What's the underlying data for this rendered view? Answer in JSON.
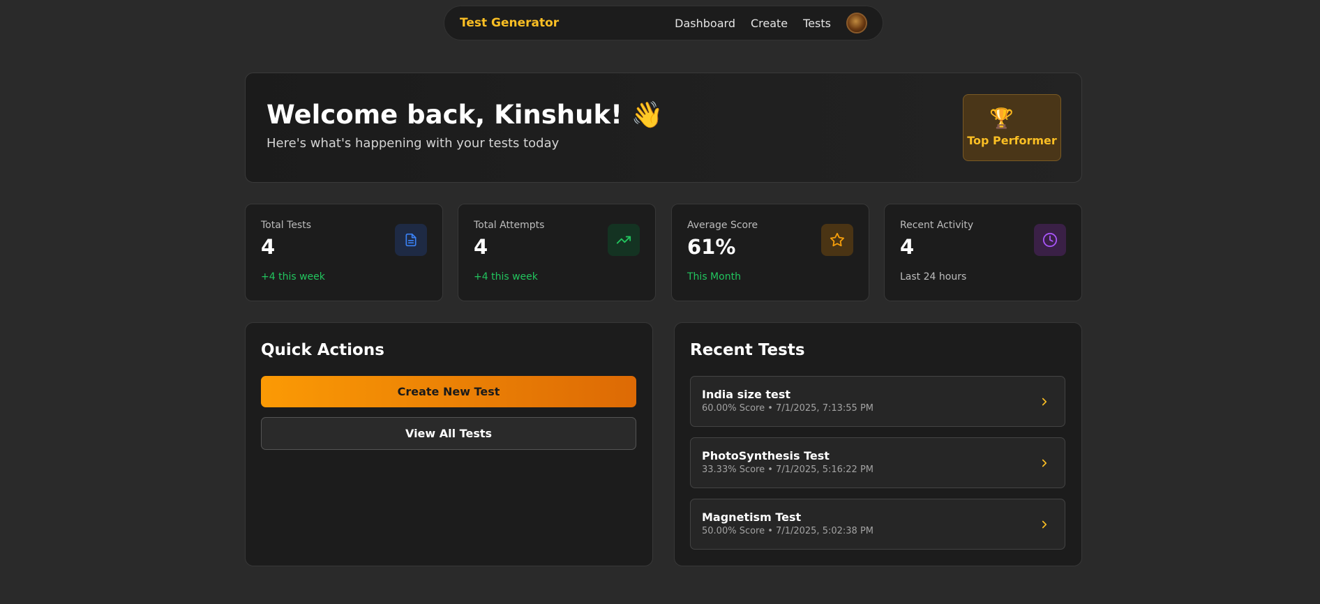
{
  "nav": {
    "brand": "Test Generator",
    "links": [
      "Dashboard",
      "Create",
      "Tests"
    ]
  },
  "welcome": {
    "title": "Welcome back, Kinshuk! 👋",
    "subtitle": "Here's what's happening with your tests today",
    "badge_icon": "🏆",
    "badge_label": "Top Performer"
  },
  "stats": [
    {
      "label": "Total Tests",
      "value": "4",
      "note": "+4 this week",
      "note_color": "#22c55e",
      "icon": "document-icon",
      "icon_bg": "#1e2a44",
      "icon_color": "#3b82f6"
    },
    {
      "label": "Total Attempts",
      "value": "4",
      "note": "+4 this week",
      "note_color": "#22c55e",
      "icon": "trending-up-icon",
      "icon_bg": "#143322",
      "icon_color": "#22c55e"
    },
    {
      "label": "Average Score",
      "value": "61%",
      "note": "This Month",
      "note_color": "#22c55e",
      "icon": "star-icon",
      "icon_bg": "#4a3414",
      "icon_color": "#f59e0b"
    },
    {
      "label": "Recent Activity",
      "value": "4",
      "note": "Last 24 hours",
      "note_color": "#bdbdbd",
      "icon": "clock-icon",
      "icon_bg": "#3a2046",
      "icon_color": "#a855f7"
    }
  ],
  "quick_actions": {
    "title": "Quick Actions",
    "create_label": "Create New Test",
    "view_label": "View All Tests"
  },
  "recent_tests": {
    "title": "Recent Tests",
    "items": [
      {
        "name": "India size test",
        "meta": "60.00% Score • 7/1/2025, 7:13:55 PM"
      },
      {
        "name": "PhotoSynthesis Test",
        "meta": "33.33% Score • 7/1/2025, 5:16:22 PM"
      },
      {
        "name": "Magnetism Test",
        "meta": "50.00% Score • 7/1/2025, 5:02:38 PM"
      }
    ]
  },
  "colors": {
    "accent": "#fbbf24",
    "primary_button": "#fb9a05",
    "background": "#2a2a2a",
    "card": "#1c1c1c"
  }
}
